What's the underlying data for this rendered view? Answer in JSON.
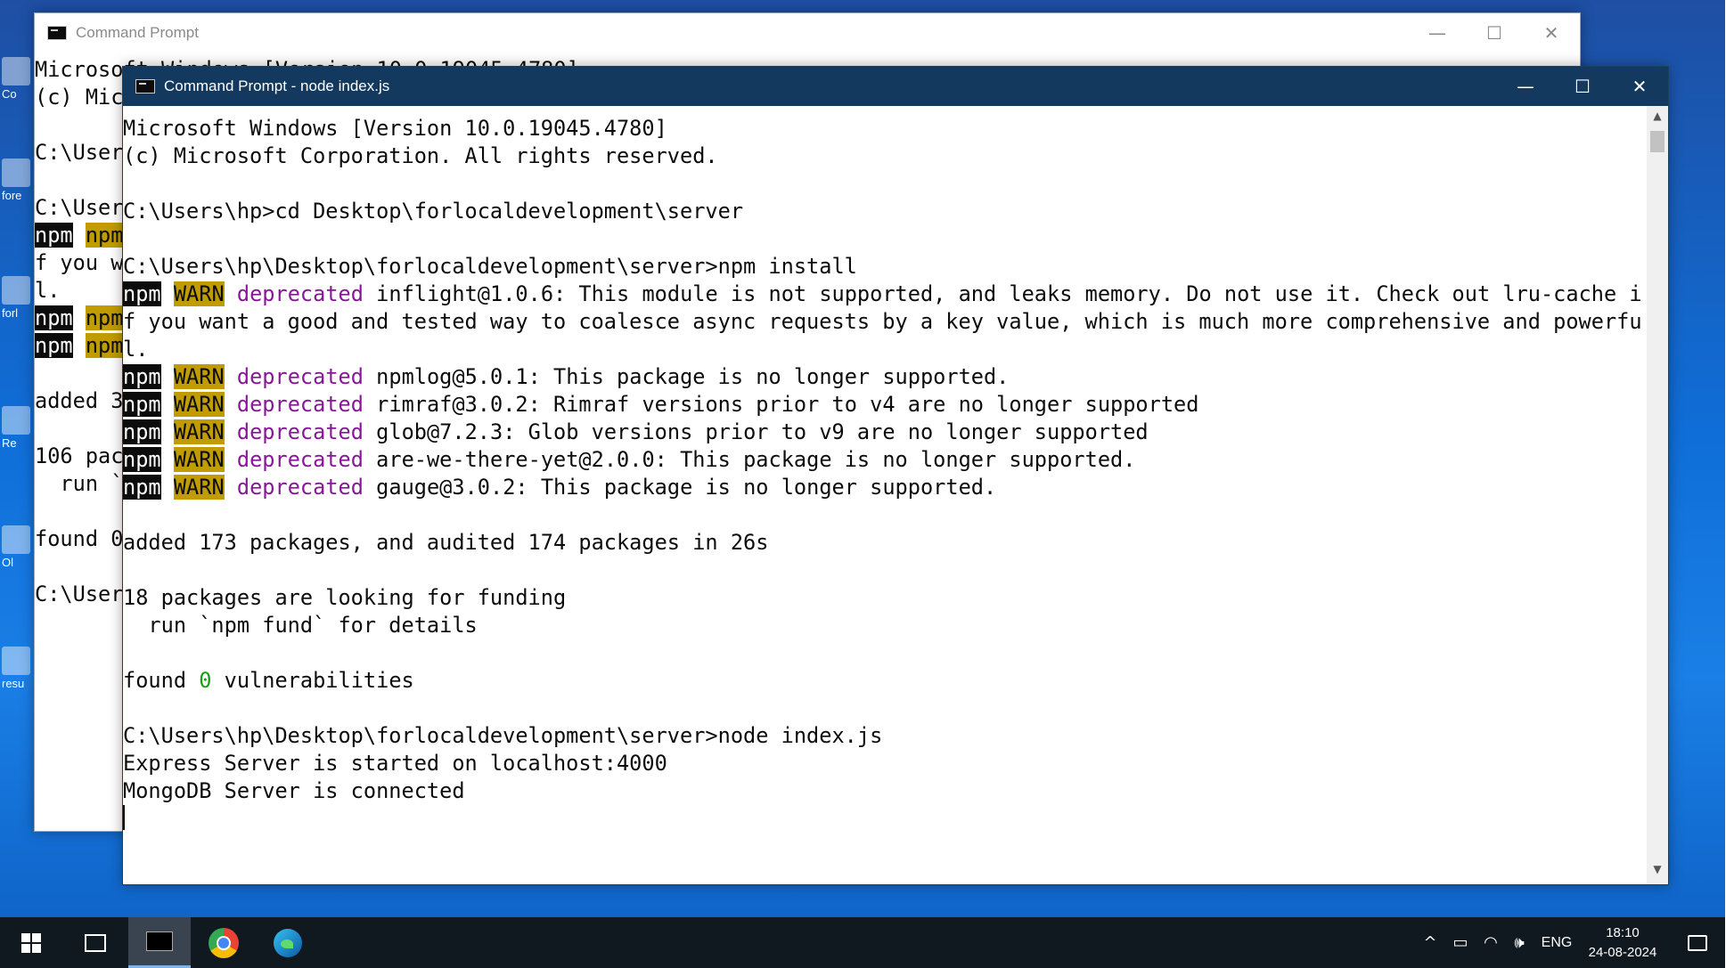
{
  "desktop": {
    "icons": [
      {
        "label": "Co"
      },
      {
        "label": "fore"
      },
      {
        "label": "forl"
      },
      {
        "label": "Re"
      },
      {
        "label": "Ol"
      },
      {
        "label": "resu"
      }
    ]
  },
  "back_window": {
    "title": "Command Prompt",
    "controls": {
      "minimize": "—",
      "maximize": "☐",
      "close": "✕"
    },
    "lines": [
      "Microsoft Windows [Version 10.0.19045.4780]",
      "(c) Mic",
      "",
      "C:\\User",
      "",
      "C:\\User",
      "npm WAR",
      "f you w",
      "l.",
      "npm WAR",
      "npm WAR",
      "",
      "added 3",
      "",
      "106 pac",
      "  run `",
      "",
      "found 0",
      "",
      "C:\\User"
    ]
  },
  "front_window": {
    "title": "Command Prompt - node  index.js",
    "controls": {
      "minimize": "—",
      "maximize": "☐",
      "close": "✕"
    },
    "console": {
      "header": [
        "Microsoft Windows [Version 10.0.19045.4780]",
        "(c) Microsoft Corporation. All rights reserved."
      ],
      "cmd_cd": "C:\\Users\\hp>cd Desktop\\forlocaldevelopment\\server",
      "cmd_npm_install": "C:\\Users\\hp\\Desktop\\forlocaldevelopment\\server>npm install",
      "npm_tag": "npm",
      "warn_tag": "WARN",
      "deprecated_tag": "deprecated",
      "inflight_text": "inflight@1.0.6: This module is not supported, and leaks memory. Do not use it. Check out lru-cache i",
      "inflight_wrap1": "f you want a good and tested way to coalesce async requests by a key value, which is much more comprehensive and powerfu",
      "inflight_wrap2": "l.",
      "warnings": [
        "npmlog@5.0.1: This package is no longer supported.",
        "rimraf@3.0.2: Rimraf versions prior to v4 are no longer supported",
        "glob@7.2.3: Glob versions prior to v9 are no longer supported",
        "are-we-there-yet@2.0.0: This package is no longer supported.",
        "gauge@3.0.2: This package is no longer supported."
      ],
      "added": "added 173 packages, and audited 174 packages in 26s",
      "funding": "18 packages are looking for funding",
      "fund_hint": "  run `npm fund` for details",
      "found_prefix": "found ",
      "found_count": "0",
      "found_suffix": " vulnerabilities",
      "cmd_node": "C:\\Users\\hp\\Desktop\\forlocaldevelopment\\server>node index.js",
      "express_msg": "Express Server is started on localhost:4000",
      "mongo_msg": "MongoDB Server is connected"
    },
    "scrollbar": {
      "up": "▲",
      "down": "▼"
    }
  },
  "taskbar": {
    "tray": {
      "chevron": "^",
      "battery": "▭",
      "wifi": "◠",
      "volume": "🕪",
      "language": "ENG",
      "time": "18:10",
      "date": "24-08-2024"
    }
  },
  "colors": {
    "npm_bg": "#0c0c0c",
    "warn_bg": "#c19c00",
    "deprecated": "#881798",
    "zero": "#13a10e",
    "front_titlebar": "#13395e",
    "taskbar": "#101820"
  }
}
